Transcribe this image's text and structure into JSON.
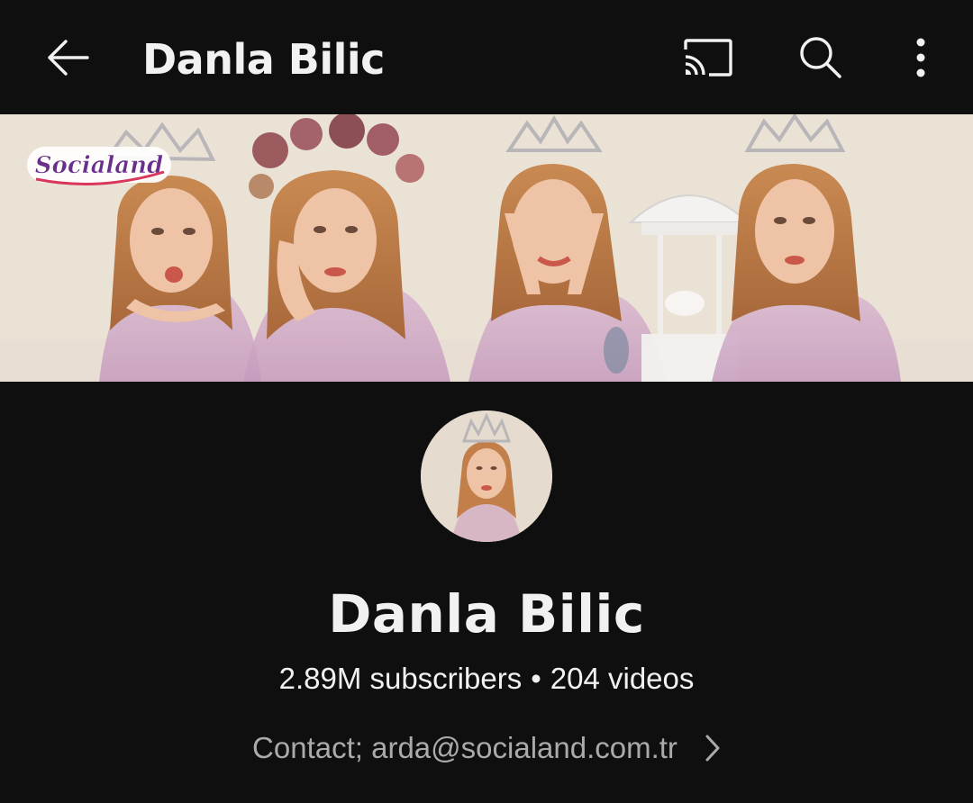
{
  "header": {
    "title": "Danla Bilic",
    "back_icon": "arrow-left-icon",
    "cast_icon": "cast-icon",
    "search_icon": "search-icon",
    "more_icon": "more-vert-icon"
  },
  "banner": {
    "logo_text": "Socialand"
  },
  "channel": {
    "name": "Danla Bilic",
    "subscribers": "2.89M subscribers",
    "separator": "•",
    "videos": "204 videos",
    "contact": "Contact; arda@socialand.com.tr",
    "chevron_icon": "chevron-right-icon"
  },
  "colors": {
    "background": "#0f0f0f",
    "text_primary": "#f1f1f1",
    "text_secondary": "#aaaaaa"
  }
}
